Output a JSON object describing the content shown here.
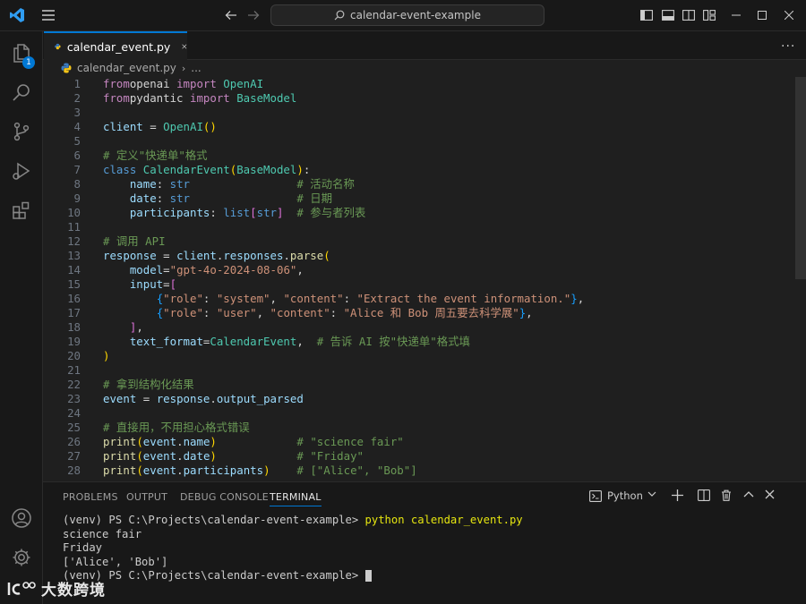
{
  "titlebar": {
    "search_text": "calendar-event-example"
  },
  "activity": {
    "explorer_badge": "1"
  },
  "tabs": [
    {
      "label": "calendar_event.py"
    }
  ],
  "breadcrumb": {
    "file": "calendar_event.py",
    "more": "..."
  },
  "editor": {
    "lines": [
      {
        "n": "1",
        "s": [
          [
            "kw",
            "from"
          ],
          [
            "",
            "openai "
          ],
          [
            "kw",
            "import"
          ],
          [
            "cls",
            " OpenAI"
          ]
        ]
      },
      {
        "n": "2",
        "s": [
          [
            "kw",
            "from"
          ],
          [
            "",
            "pydantic "
          ],
          [
            "kw",
            "import"
          ],
          [
            "cls",
            " BaseModel"
          ]
        ]
      },
      {
        "n": "3",
        "s": []
      },
      {
        "n": "4",
        "s": [
          [
            "var",
            "client"
          ],
          [
            "",
            " = "
          ],
          [
            "cls",
            "OpenAI"
          ],
          [
            "br1",
            "()"
          ]
        ]
      },
      {
        "n": "5",
        "s": []
      },
      {
        "n": "6",
        "s": [
          [
            "cm",
            "# 定义\"快递单\"格式"
          ]
        ]
      },
      {
        "n": "7",
        "s": [
          [
            "kb",
            "class"
          ],
          [
            "cls",
            " CalendarEvent"
          ],
          [
            "br1",
            "("
          ],
          [
            "cls",
            "BaseModel"
          ],
          [
            "br1",
            ")"
          ],
          [
            "",
            ":"
          ]
        ]
      },
      {
        "n": "8",
        "s": [
          [
            "",
            "    "
          ],
          [
            "var",
            "name"
          ],
          [
            "",
            ": "
          ],
          [
            "kb",
            "str"
          ],
          [
            "",
            "                "
          ],
          [
            "cm",
            "# 活动名称"
          ]
        ]
      },
      {
        "n": "9",
        "s": [
          [
            "",
            "    "
          ],
          [
            "var",
            "date"
          ],
          [
            "",
            ": "
          ],
          [
            "kb",
            "str"
          ],
          [
            "",
            "                "
          ],
          [
            "cm",
            "# 日期"
          ]
        ]
      },
      {
        "n": "10",
        "s": [
          [
            "",
            "    "
          ],
          [
            "var",
            "participants"
          ],
          [
            "",
            ": "
          ],
          [
            "kb",
            "list"
          ],
          [
            "br2",
            "["
          ],
          [
            "kb",
            "str"
          ],
          [
            "br2",
            "]"
          ],
          [
            "",
            "  "
          ],
          [
            "cm",
            "# 参与者列表"
          ]
        ]
      },
      {
        "n": "11",
        "s": []
      },
      {
        "n": "12",
        "s": [
          [
            "cm",
            "# 调用 API"
          ]
        ]
      },
      {
        "n": "13",
        "s": [
          [
            "var",
            "response"
          ],
          [
            "",
            " = "
          ],
          [
            "var",
            "client"
          ],
          [
            "",
            "."
          ],
          [
            "var",
            "responses"
          ],
          [
            "",
            "."
          ],
          [
            "fn",
            "parse"
          ],
          [
            "br1",
            "("
          ]
        ]
      },
      {
        "n": "14",
        "s": [
          [
            "",
            "    "
          ],
          [
            "var",
            "model"
          ],
          [
            "",
            "="
          ],
          [
            "str",
            "\"gpt-4o-2024-08-06\""
          ],
          [
            "",
            ","
          ]
        ]
      },
      {
        "n": "15",
        "s": [
          [
            "",
            "    "
          ],
          [
            "var",
            "input"
          ],
          [
            "",
            "="
          ],
          [
            "br2",
            "["
          ]
        ]
      },
      {
        "n": "16",
        "s": [
          [
            "",
            "        "
          ],
          [
            "br3",
            "{"
          ],
          [
            "str",
            "\"role\""
          ],
          [
            "",
            ": "
          ],
          [
            "str",
            "\"system\""
          ],
          [
            "",
            ", "
          ],
          [
            "str",
            "\"content\""
          ],
          [
            "",
            ": "
          ],
          [
            "str",
            "\"Extract the event information.\""
          ],
          [
            "br3",
            "}"
          ],
          [
            "",
            ","
          ]
        ]
      },
      {
        "n": "17",
        "s": [
          [
            "",
            "        "
          ],
          [
            "br3",
            "{"
          ],
          [
            "str",
            "\"role\""
          ],
          [
            "",
            ": "
          ],
          [
            "str",
            "\"user\""
          ],
          [
            "",
            ", "
          ],
          [
            "str",
            "\"content\""
          ],
          [
            "",
            ": "
          ],
          [
            "str",
            "\"Alice 和 Bob 周五要去科学展\""
          ],
          [
            "br3",
            "}"
          ],
          [
            "",
            ","
          ]
        ]
      },
      {
        "n": "18",
        "s": [
          [
            "",
            "    "
          ],
          [
            "br2",
            "]"
          ],
          [
            "",
            ","
          ]
        ]
      },
      {
        "n": "19",
        "s": [
          [
            "",
            "    "
          ],
          [
            "var",
            "text_format"
          ],
          [
            "",
            "="
          ],
          [
            "cls",
            "CalendarEvent"
          ],
          [
            "",
            ",  "
          ],
          [
            "cm",
            "# 告诉 AI 按\"快递单\"格式填"
          ]
        ]
      },
      {
        "n": "20",
        "s": [
          [
            "br1",
            ")"
          ]
        ]
      },
      {
        "n": "21",
        "s": []
      },
      {
        "n": "22",
        "s": [
          [
            "cm",
            "# 拿到结构化结果"
          ]
        ]
      },
      {
        "n": "23",
        "s": [
          [
            "var",
            "event"
          ],
          [
            "",
            " = "
          ],
          [
            "var",
            "response"
          ],
          [
            "",
            "."
          ],
          [
            "var",
            "output_parsed"
          ]
        ]
      },
      {
        "n": "24",
        "s": []
      },
      {
        "n": "25",
        "s": [
          [
            "cm",
            "# 直接用，不用担心格式错误"
          ]
        ]
      },
      {
        "n": "26",
        "s": [
          [
            "fn",
            "print"
          ],
          [
            "br1",
            "("
          ],
          [
            "var",
            "event"
          ],
          [
            "",
            "."
          ],
          [
            "var",
            "name"
          ],
          [
            "br1",
            ")"
          ],
          [
            "",
            "            "
          ],
          [
            "cm",
            "# \"science fair\""
          ]
        ]
      },
      {
        "n": "27",
        "s": [
          [
            "fn",
            "print"
          ],
          [
            "br1",
            "("
          ],
          [
            "var",
            "event"
          ],
          [
            "",
            "."
          ],
          [
            "var",
            "date"
          ],
          [
            "br1",
            ")"
          ],
          [
            "",
            "            "
          ],
          [
            "cm",
            "# \"Friday\""
          ]
        ]
      },
      {
        "n": "28",
        "s": [
          [
            "fn",
            "print"
          ],
          [
            "br1",
            "("
          ],
          [
            "var",
            "event"
          ],
          [
            "",
            "."
          ],
          [
            "var",
            "participants"
          ],
          [
            "br1",
            ")"
          ],
          [
            "",
            "    "
          ],
          [
            "cm",
            "# [\"Alice\", \"Bob\"]"
          ]
        ]
      }
    ]
  },
  "panel": {
    "tabs": [
      "PROBLEMS",
      "OUTPUT",
      "DEBUG CONSOLE",
      "TERMINAL"
    ],
    "shell": "Python",
    "terminal": {
      "prompt1": "(venv) PS C:\\Projects\\calendar-event-example> ",
      "command": "python calendar_event.py",
      "out1": "science fair",
      "out2": "Friday",
      "out3": "['Alice', 'Bob']",
      "prompt2": "(venv) PS C:\\Projects\\calendar-event-example> "
    }
  },
  "watermark": {
    "text": "大数跨境"
  },
  "colors": {
    "accent": "#0078d4",
    "background": "#1f1f1f",
    "chrome": "#181818"
  }
}
